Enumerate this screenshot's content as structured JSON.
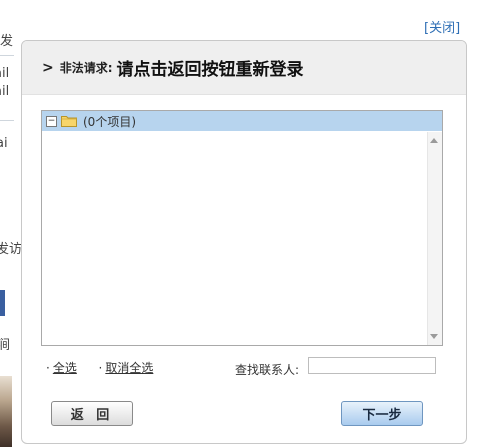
{
  "background": {
    "fragments": [
      "发",
      "ail",
      "ail",
      "ai",
      "发访",
      "涧"
    ]
  },
  "close_label": "[关闭]",
  "dialog": {
    "arrow": ">",
    "request_label": "非法请求:",
    "request_message": "请点击返回按钮重新登录",
    "tree": {
      "expander": "⊟",
      "root_label": "(0个项目)"
    },
    "select_all": "全选",
    "deselect_all": "取消全选",
    "search_label": "查找联系人:",
    "search_value": "",
    "back_button": "返 回",
    "next_button": "下一步"
  },
  "colors": {
    "tree_highlight": "#b7d4ee",
    "link": "#2f6fb5",
    "header_bg": "#efefef"
  }
}
